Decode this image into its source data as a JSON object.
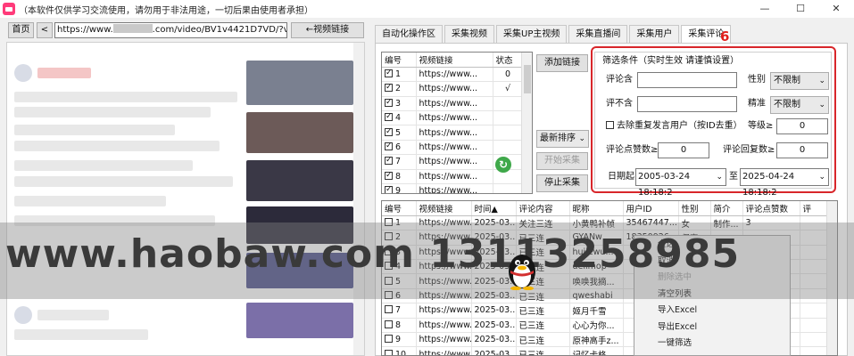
{
  "window": {
    "title": "（本软件仅供学习交流使用，请勿用于非法用途，一切后果由使用者承担）",
    "controls": [
      "—",
      "☐",
      "✕"
    ]
  },
  "browser": {
    "home_label": "首页",
    "back_label": "<",
    "url_prefix": "https://www.",
    "url_suffix": ".com/video/BV1v4421D7VD/?vd_source",
    "go_label": "←视频链接"
  },
  "tabs": [
    "自动化操作区",
    "采集视频",
    "采集UP主视频",
    "采集直播间",
    "采集用户",
    "采集评论"
  ],
  "annotation": "6",
  "link_grid": {
    "headers": [
      "编号",
      "视频链接",
      "状态"
    ],
    "rows": [
      {
        "checked": true,
        "no": "1",
        "link": "https://www...",
        "status": "0"
      },
      {
        "checked": true,
        "no": "2",
        "link": "https://www...",
        "status": "√"
      },
      {
        "checked": true,
        "no": "3",
        "link": "https://www...",
        "status": ""
      },
      {
        "checked": true,
        "no": "4",
        "link": "https://www...",
        "status": ""
      },
      {
        "checked": true,
        "no": "5",
        "link": "https://www...",
        "status": ""
      },
      {
        "checked": true,
        "no": "6",
        "link": "https://www...",
        "status": ""
      },
      {
        "checked": true,
        "no": "7",
        "link": "https://www...",
        "status": ""
      },
      {
        "checked": true,
        "no": "8",
        "link": "https://www...",
        "status": ""
      },
      {
        "checked": true,
        "no": "9",
        "link": "https://www...",
        "status": ""
      }
    ]
  },
  "buttons": {
    "add_link": "添加链接",
    "sort": "最新排序",
    "start": "开始采集",
    "stop": "停止采集"
  },
  "filter": {
    "title": "筛选条件（实时生效 请谨慎设置）",
    "include_label": "评论含",
    "exclude_label": "评不含",
    "gender_label": "性别",
    "gender_value": "不限制",
    "medal_label": "精准",
    "medal_value": "不限制",
    "dedupe_label": "去除重复发言用户（按ID去重）",
    "level_label": "等级≥",
    "level_value": "0",
    "likes_label": "评论点赞数≥",
    "likes_value": "0",
    "replies_label": "评论回复数≥",
    "replies_value": "0",
    "date_label": "日期起",
    "date_from": "2005-03-24 18:18:2",
    "date_to_label": "至",
    "date_to": "2025-04-24 18:18:2"
  },
  "result_grid": {
    "headers": [
      "编号",
      "视频链接",
      "时间▲",
      "评论内容",
      "昵称",
      "用户ID",
      "性别",
      "简介",
      "评论点赞数",
      "评"
    ],
    "rows": [
      {
        "no": "1",
        "link": "https://www...",
        "time": "2025-03...",
        "content": "关注三连",
        "nick": "小黄鸭补帧",
        "uid": "35467447...",
        "gender": "女",
        "bio": "制作...",
        "likes": "3"
      },
      {
        "no": "2",
        "link": "https://www...",
        "time": "2025-03...",
        "content": "已三连",
        "nick": "GYANw",
        "uid": "18350926...",
        "gender": "保密",
        "bio": "",
        "likes": ""
      },
      {
        "no": "3",
        "link": "https://www...",
        "time": "2025-03...",
        "content": "已三连",
        "nick": "hujiewu...",
        "uid": "",
        "gender": "",
        "bio": "",
        "likes": ""
      },
      {
        "no": "4",
        "link": "https://www...",
        "time": "2025-03...",
        "content": "已三连",
        "nick": "dellmop",
        "uid": "",
        "gender": "",
        "bio": "",
        "likes": ""
      },
      {
        "no": "5",
        "link": "https://www...",
        "time": "2025-03...",
        "content": "已三连",
        "nick": "唤唤我摘...",
        "uid": "",
        "gender": "",
        "bio": "",
        "likes": ""
      },
      {
        "no": "6",
        "link": "https://www...",
        "time": "2025-03...",
        "content": "已三连",
        "nick": "qweshabi",
        "uid": "",
        "gender": "",
        "bio": "",
        "likes": ""
      },
      {
        "no": "7",
        "link": "https://www...",
        "time": "2025-03...",
        "content": "已三连",
        "nick": "姬月千雪",
        "uid": "",
        "gender": "",
        "bio": "",
        "likes": ""
      },
      {
        "no": "8",
        "link": "https://www...",
        "time": "2025-03...",
        "content": "已三连",
        "nick": "心心为你...",
        "uid": "",
        "gender": "",
        "bio": "",
        "likes": ""
      },
      {
        "no": "9",
        "link": "https://www...",
        "time": "2025-03...",
        "content": "已三连",
        "nick": "原神高手z...",
        "uid": "",
        "gender": "",
        "bio": "",
        "likes": ""
      },
      {
        "no": "10",
        "link": "https://www...",
        "time": "2025-03...",
        "content": "已三连",
        "nick": "记忆卡格",
        "uid": "",
        "gender": "",
        "bio": "",
        "likes": ""
      }
    ]
  },
  "context_menu": [
    {
      "label": "全选",
      "dim": false
    },
    {
      "label": "取消",
      "dim": false
    },
    {
      "label": "删除选中",
      "dim": true
    },
    {
      "label": "清空列表",
      "dim": false
    },
    {
      "label": "导入Excel",
      "dim": false
    },
    {
      "label": "导出Excel",
      "dim": false
    },
    {
      "label": "一键筛选",
      "dim": false
    }
  ],
  "watermark": "www.haobaw.com  13113258985",
  "colors": {
    "annotation_red": "#d8262a",
    "refresh_green": "#3fa84a",
    "app_icon": "#ff3b7a"
  }
}
